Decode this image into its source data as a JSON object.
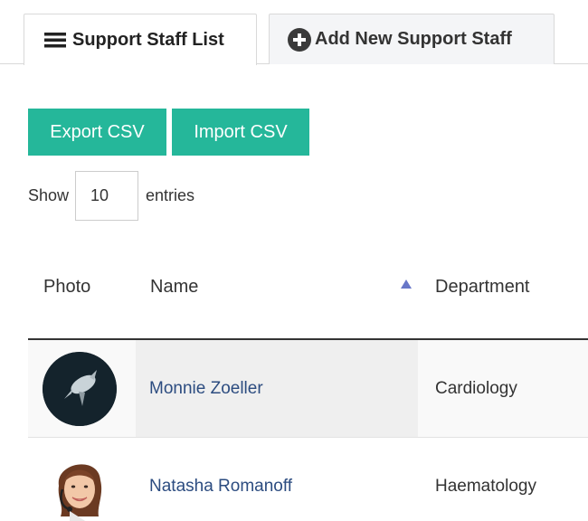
{
  "tabs": {
    "list_label": "Support Staff List",
    "add_label": "Add New Support Staff"
  },
  "actions": {
    "export_label": "Export CSV",
    "import_label": "Import CSV"
  },
  "entries": {
    "show_label": "Show",
    "value": "10",
    "suffix_label": "entries"
  },
  "table": {
    "columns": [
      "Photo",
      "Name",
      "Department"
    ],
    "rows": [
      {
        "name": "Monnie Zoeller",
        "department": "Cardiology"
      },
      {
        "name": "Natasha Romanoff",
        "department": "Haematology"
      }
    ]
  },
  "colors": {
    "accent": "#25b79a",
    "link": "#2c4c80",
    "sort_arrow": "#6877c8"
  }
}
